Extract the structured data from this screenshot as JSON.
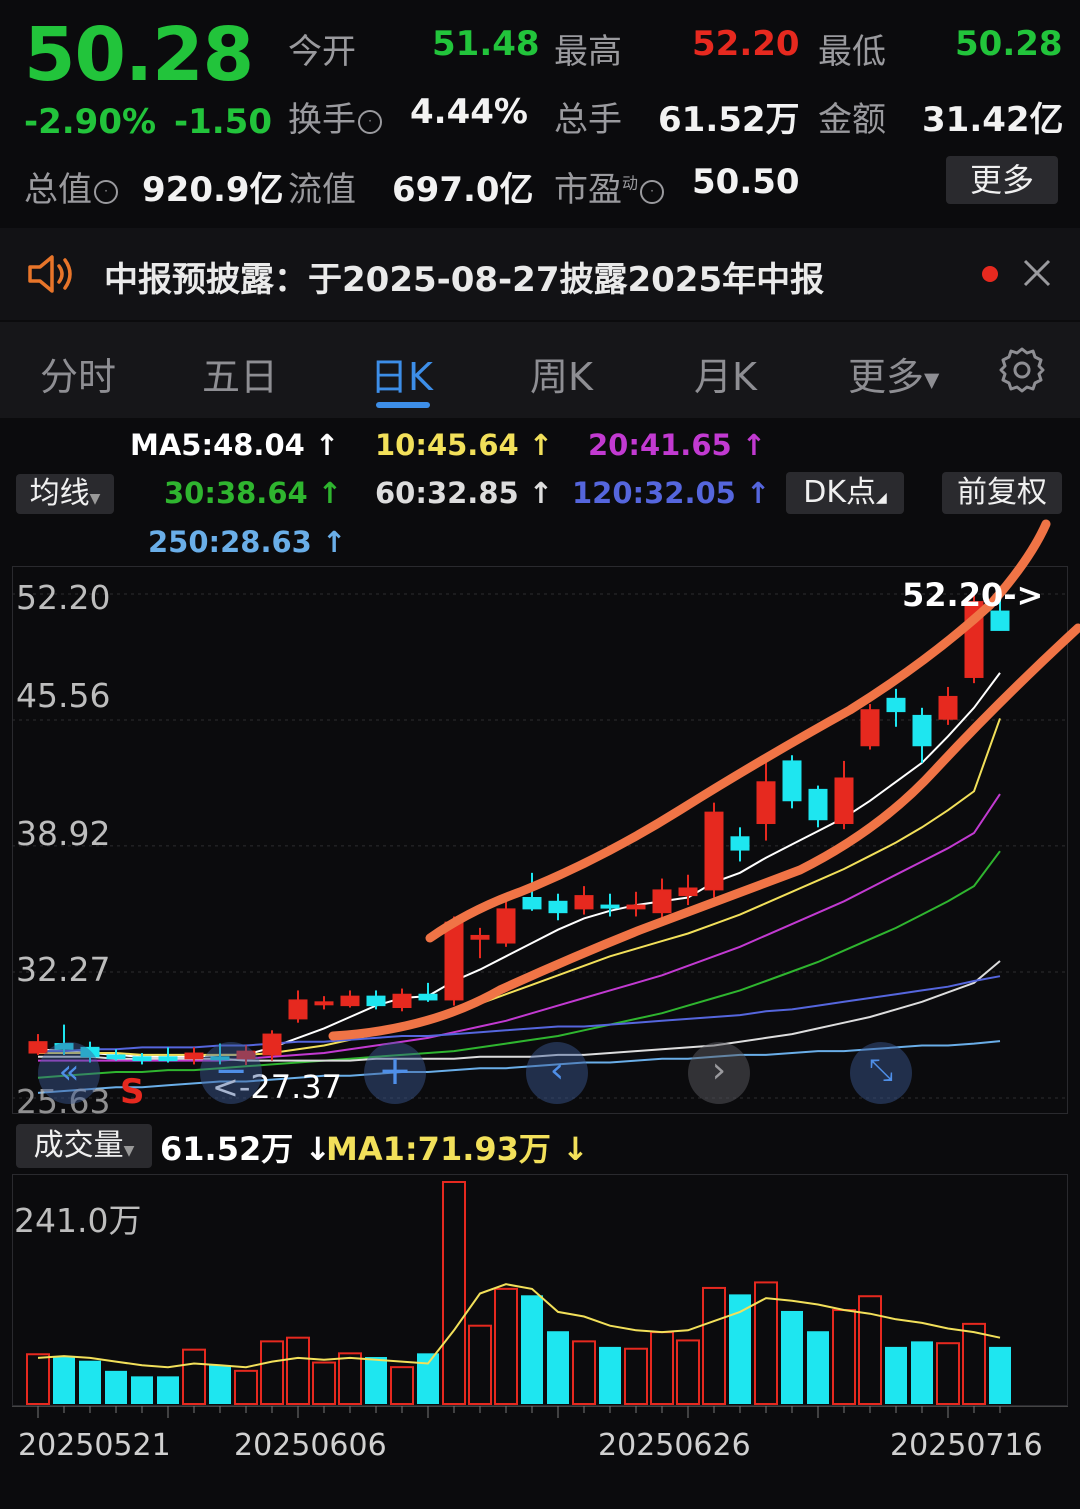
{
  "quote": {
    "price": "50.28",
    "change_pct": "-2.90%",
    "change_abs": "-1.50",
    "open_label": "今开",
    "open_value": "51.48",
    "high_label": "最高",
    "high_value": "52.20",
    "low_label": "最低",
    "low_value": "50.28",
    "turnover_label": "换手",
    "turnover_value": "4.44%",
    "volume_label": "总手",
    "volume_value": "61.52万",
    "amount_label": "金额",
    "amount_value": "31.42亿",
    "mktcap_label": "总值",
    "mktcap_value": "920.9亿",
    "float_label": "流值",
    "float_value": "697.0亿",
    "pe_label": "市盈",
    "pe_superscript": "动",
    "pe_value": "50.50",
    "more_label": "更多"
  },
  "notice": {
    "icon": "speaker-icon",
    "text": "中报预披露：于2025-08-27披露2025年中报"
  },
  "tabs": [
    {
      "label": "分时"
    },
    {
      "label": "五日"
    },
    {
      "label": "日K"
    },
    {
      "label": "周K"
    },
    {
      "label": "月K"
    },
    {
      "label": "更多"
    }
  ],
  "indicators": {
    "ma_toggle": "均线",
    "ma5": "MA5:48.04",
    "ma10": "10:45.64",
    "ma20": "20:41.65",
    "ma30": "30:38.64",
    "ma60": "60:32.85",
    "ma120": "120:32.05",
    "ma250": "250:28.63",
    "dk_label": "DK点",
    "adjust_label": "前复权",
    "colors": {
      "ma5": "#ffffff",
      "ma10": "#f2e05a",
      "ma20": "#c23ad1",
      "ma30": "#2fb52f",
      "ma60": "#dddddd",
      "ma120": "#5566dd",
      "ma250": "#6aaee8"
    }
  },
  "price_axis": [
    "52.20",
    "45.56",
    "38.92",
    "32.27",
    "25.63"
  ],
  "price_annotations": {
    "high_marker": "52.20->",
    "low_marker": "<-27.37",
    "sell_marker": "S"
  },
  "volume_panel": {
    "selector_label": "成交量",
    "volume_value": "61.52万",
    "ma1_value": "MA1:71.93万",
    "axis_max": "241.0万"
  },
  "dates": [
    "20250521",
    "20250606",
    "20250626",
    "20250716"
  ],
  "chart_data": {
    "type": "candlestick",
    "ylim": [
      25.63,
      52.2
    ],
    "candles": [
      {
        "o": 28.6,
        "h": 29.0,
        "l": 27.9,
        "c": 28.0,
        "v": 54,
        "up": true
      },
      {
        "o": 28.5,
        "h": 29.5,
        "l": 27.9,
        "c": 28.2,
        "v": 52,
        "up": false
      },
      {
        "o": 28.3,
        "h": 28.6,
        "l": 27.5,
        "c": 27.8,
        "v": 47,
        "up": false
      },
      {
        "o": 27.9,
        "h": 28.2,
        "l": 27.6,
        "c": 27.7,
        "v": 36,
        "up": false
      },
      {
        "o": 27.6,
        "h": 28.0,
        "l": 27.4,
        "c": 27.8,
        "v": 30,
        "up": false
      },
      {
        "o": 27.8,
        "h": 28.3,
        "l": 27.5,
        "c": 27.6,
        "v": 30,
        "up": false
      },
      {
        "o": 27.7,
        "h": 28.3,
        "l": 27.4,
        "c": 28.0,
        "v": 59,
        "up": true
      },
      {
        "o": 27.8,
        "h": 28.5,
        "l": 27.4,
        "c": 27.7,
        "v": 42,
        "up": false
      },
      {
        "o": 27.7,
        "h": 28.4,
        "l": 27.37,
        "c": 28.1,
        "v": 36,
        "up": true
      },
      {
        "o": 27.9,
        "h": 29.2,
        "l": 27.6,
        "c": 29.0,
        "v": 68,
        "up": true
      },
      {
        "o": 29.8,
        "h": 31.3,
        "l": 29.6,
        "c": 30.8,
        "v": 72,
        "up": true
      },
      {
        "o": 30.6,
        "h": 31.0,
        "l": 30.3,
        "c": 30.7,
        "v": 45,
        "up": true
      },
      {
        "o": 30.5,
        "h": 31.3,
        "l": 30.4,
        "c": 31.0,
        "v": 55,
        "up": true
      },
      {
        "o": 31.0,
        "h": 31.3,
        "l": 30.3,
        "c": 30.5,
        "v": 51,
        "up": false
      },
      {
        "o": 30.4,
        "h": 31.4,
        "l": 30.2,
        "c": 31.1,
        "v": 40,
        "up": true
      },
      {
        "o": 31.1,
        "h": 31.7,
        "l": 30.7,
        "c": 30.8,
        "v": 55,
        "up": false
      },
      {
        "o": 30.8,
        "h": 35.2,
        "l": 30.5,
        "c": 34.9,
        "v": 241,
        "up": true
      },
      {
        "o": 34.0,
        "h": 34.6,
        "l": 33.0,
        "c": 34.2,
        "v": 85,
        "up": true
      },
      {
        "o": 33.8,
        "h": 36.0,
        "l": 33.6,
        "c": 35.6,
        "v": 125,
        "up": true
      },
      {
        "o": 36.2,
        "h": 37.5,
        "l": 35.5,
        "c": 35.6,
        "v": 118,
        "up": false
      },
      {
        "o": 35.4,
        "h": 36.4,
        "l": 35.0,
        "c": 36.0,
        "v": 79,
        "up": false
      },
      {
        "o": 35.6,
        "h": 36.8,
        "l": 35.3,
        "c": 36.3,
        "v": 68,
        "up": true
      },
      {
        "o": 35.8,
        "h": 36.4,
        "l": 35.2,
        "c": 35.8,
        "v": 62,
        "up": false
      },
      {
        "o": 35.6,
        "h": 36.5,
        "l": 35.2,
        "c": 35.8,
        "v": 60,
        "up": true
      },
      {
        "o": 35.4,
        "h": 37.2,
        "l": 35.1,
        "c": 36.6,
        "v": 78,
        "up": true
      },
      {
        "o": 36.3,
        "h": 37.4,
        "l": 35.8,
        "c": 36.7,
        "v": 69,
        "up": true
      },
      {
        "o": 36.6,
        "h": 41.2,
        "l": 36.2,
        "c": 40.7,
        "v": 126,
        "up": true
      },
      {
        "o": 39.4,
        "h": 39.9,
        "l": 38.1,
        "c": 38.7,
        "v": 119,
        "up": false
      },
      {
        "o": 40.1,
        "h": 43.4,
        "l": 39.2,
        "c": 42.3,
        "v": 132,
        "up": true
      },
      {
        "o": 43.4,
        "h": 43.7,
        "l": 40.9,
        "c": 41.3,
        "v": 101,
        "up": false
      },
      {
        "o": 41.9,
        "h": 42.1,
        "l": 39.9,
        "c": 40.3,
        "v": 79,
        "up": false
      },
      {
        "o": 40.1,
        "h": 43.4,
        "l": 39.8,
        "c": 42.5,
        "v": 102,
        "up": true
      },
      {
        "o": 44.2,
        "h": 46.4,
        "l": 44.0,
        "c": 46.1,
        "v": 117,
        "up": true
      },
      {
        "o": 46.7,
        "h": 47.2,
        "l": 45.2,
        "c": 46.0,
        "v": 62,
        "up": false
      },
      {
        "o": 45.8,
        "h": 46.2,
        "l": 43.3,
        "c": 44.2,
        "v": 68,
        "up": false
      },
      {
        "o": 45.6,
        "h": 47.3,
        "l": 45.3,
        "c": 46.8,
        "v": 66,
        "up": true
      },
      {
        "o": 47.8,
        "h": 52.2,
        "l": 47.5,
        "c": 51.8,
        "v": 87,
        "up": true
      },
      {
        "o": 51.3,
        "h": 52.2,
        "l": 50.28,
        "c": 50.28,
        "v": 62,
        "up": false
      }
    ],
    "ma_series": {
      "ma5": [
        28.2,
        28.1,
        28.0,
        27.9,
        27.8,
        27.8,
        27.8,
        27.9,
        27.9,
        28.3,
        28.8,
        29.3,
        29.9,
        30.5,
        30.9,
        31.0,
        31.8,
        32.4,
        33.1,
        33.8,
        34.5,
        35.1,
        35.5,
        35.8,
        36.0,
        36.2,
        37.0,
        37.5,
        38.3,
        39.0,
        39.7,
        40.4,
        41.3,
        42.3,
        43.3,
        44.7,
        46.2,
        48.04
      ],
      "ma10": [
        28.0,
        28.0,
        28.0,
        28.0,
        27.9,
        27.9,
        27.9,
        27.9,
        27.9,
        28.0,
        28.2,
        28.4,
        28.7,
        29.0,
        29.3,
        29.6,
        30.1,
        30.6,
        31.1,
        31.6,
        32.1,
        32.6,
        33.1,
        33.5,
        33.9,
        34.3,
        34.8,
        35.3,
        35.9,
        36.5,
        37.1,
        37.7,
        38.4,
        39.1,
        39.9,
        40.8,
        41.8,
        45.64
      ],
      "ma20": [
        27.6,
        27.6,
        27.6,
        27.6,
        27.6,
        27.6,
        27.6,
        27.6,
        27.7,
        27.8,
        27.9,
        28.0,
        28.2,
        28.4,
        28.6,
        28.8,
        29.1,
        29.4,
        29.7,
        30.1,
        30.5,
        30.9,
        31.3,
        31.7,
        32.1,
        32.6,
        33.1,
        33.6,
        34.2,
        34.8,
        35.4,
        36.0,
        36.7,
        37.4,
        38.1,
        38.8,
        39.6,
        41.65
      ],
      "ma30": [
        26.7,
        26.8,
        26.9,
        27.0,
        27.0,
        27.1,
        27.1,
        27.2,
        27.3,
        27.4,
        27.5,
        27.6,
        27.7,
        27.8,
        27.9,
        28.0,
        28.1,
        28.3,
        28.5,
        28.7,
        28.9,
        29.2,
        29.5,
        29.8,
        30.1,
        30.5,
        30.9,
        31.3,
        31.8,
        32.3,
        32.8,
        33.4,
        34.0,
        34.6,
        35.3,
        36.0,
        36.8,
        38.64
      ],
      "ma60": [
        27.8,
        27.8,
        27.8,
        27.7,
        27.7,
        27.7,
        27.7,
        27.7,
        27.6,
        27.6,
        27.6,
        27.6,
        27.6,
        27.7,
        27.7,
        27.7,
        27.7,
        27.8,
        27.8,
        27.8,
        27.9,
        27.9,
        28.0,
        28.1,
        28.2,
        28.3,
        28.4,
        28.6,
        28.8,
        29.0,
        29.3,
        29.6,
        29.9,
        30.3,
        30.7,
        31.2,
        31.7,
        32.85
      ],
      "ma120": [
        28.1,
        28.1,
        28.2,
        28.2,
        28.3,
        28.3,
        28.3,
        28.4,
        28.4,
        28.5,
        28.6,
        28.6,
        28.7,
        28.8,
        28.9,
        28.9,
        29.0,
        29.1,
        29.2,
        29.3,
        29.4,
        29.4,
        29.5,
        29.6,
        29.7,
        29.8,
        29.9,
        30.0,
        30.2,
        30.3,
        30.5,
        30.7,
        30.9,
        31.1,
        31.3,
        31.5,
        31.8,
        32.05
      ],
      "ma250": [
        25.9,
        26.0,
        26.1,
        26.2,
        26.2,
        26.3,
        26.4,
        26.5,
        26.5,
        26.6,
        26.7,
        26.8,
        26.8,
        26.9,
        27.0,
        27.0,
        27.1,
        27.2,
        27.2,
        27.3,
        27.4,
        27.5,
        27.5,
        27.6,
        27.7,
        27.7,
        27.8,
        27.9,
        27.9,
        28.0,
        28.1,
        28.1,
        28.2,
        28.3,
        28.4,
        28.4,
        28.5,
        28.63
      ]
    },
    "volume_ma": [
      50,
      52,
      50,
      46,
      42,
      40,
      44,
      42,
      40,
      46,
      50,
      48,
      50,
      48,
      46,
      44,
      80,
      120,
      130,
      125,
      100,
      95,
      85,
      80,
      78,
      80,
      90,
      100,
      115,
      112,
      108,
      102,
      98,
      92,
      88,
      82,
      78,
      72
    ]
  }
}
